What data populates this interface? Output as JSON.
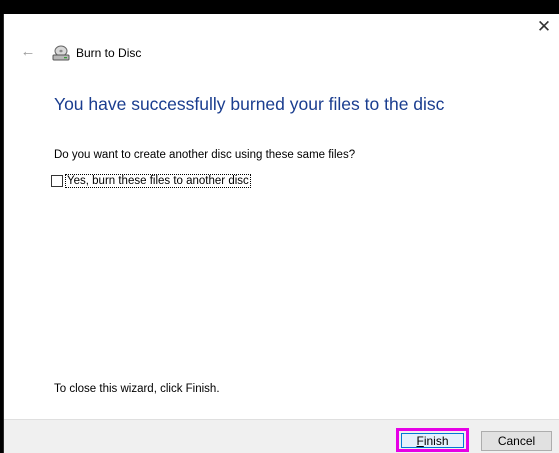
{
  "window": {
    "close_glyph": "✕",
    "back_glyph": "←",
    "title": "Burn to Disc",
    "title_icon": "disc-drive-icon"
  },
  "content": {
    "heading": "You have successfully burned your files to the disc",
    "question": "Do you want to create another disc using these same files?",
    "checkbox_label": "Yes, burn these files to another disc",
    "checkbox_checked": false,
    "bottom_note": "To close this wizard, click Finish."
  },
  "footer": {
    "finish_label_underlined": "F",
    "finish_label_rest": "inish",
    "cancel_label": "Cancel"
  },
  "colors": {
    "heading": "#1a3d8f",
    "highlight": "#e600e6",
    "footer_bg": "#f0f0f0"
  }
}
